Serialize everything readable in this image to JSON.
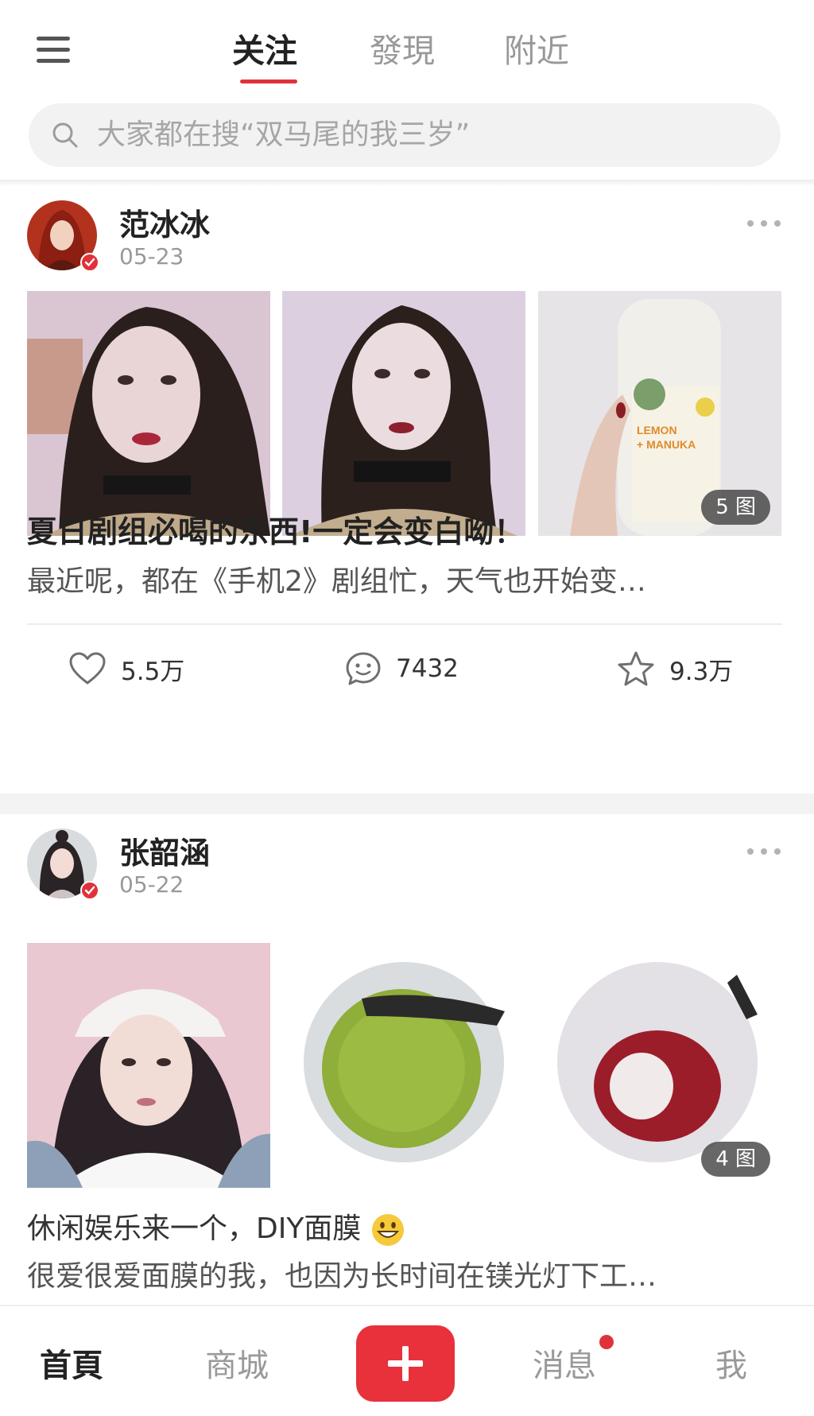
{
  "header": {
    "tabs": [
      {
        "label": "关注",
        "active": true
      },
      {
        "label": "發現",
        "active": false
      },
      {
        "label": "附近",
        "active": false
      }
    ],
    "search_placeholder": "大家都在搜“双马尾的我三岁”"
  },
  "posts": [
    {
      "username": "范冰冰",
      "date": "05-23",
      "image_count": "5 图",
      "title": "夏日剧组必喝的东西!一定会变白呦！",
      "excerpt": "最近呢，都在《手机2》剧组忙，天气也开始变…",
      "likes": "5.5万",
      "comments": "7432",
      "collects": "9.3万",
      "images": [
        "selfie-photo",
        "selfie-photo",
        "juice-bottle-photo"
      ],
      "bottle_label": "LEMON + MANUKA"
    },
    {
      "username": "张韶涵",
      "date": "05-22",
      "image_count": "4 图",
      "line1": "休闲娱乐来一个，DIY面膜",
      "line2": "很爱很爱面膜的我，也因为长时间在镁光灯下工…",
      "images": [
        "selfie-photo",
        "green-mask-photo",
        "red-mask-photo"
      ]
    }
  ],
  "bottom_nav": {
    "items": [
      {
        "label": "首頁",
        "active": true
      },
      {
        "label": "商城",
        "active": false
      },
      {
        "label": "消息",
        "active": false,
        "has_badge": true
      },
      {
        "label": "我",
        "active": false
      }
    ],
    "add_icon": "plus-icon"
  },
  "colors": {
    "accent": "#e0323b",
    "text_primary": "#222222",
    "text_secondary": "#999999"
  }
}
